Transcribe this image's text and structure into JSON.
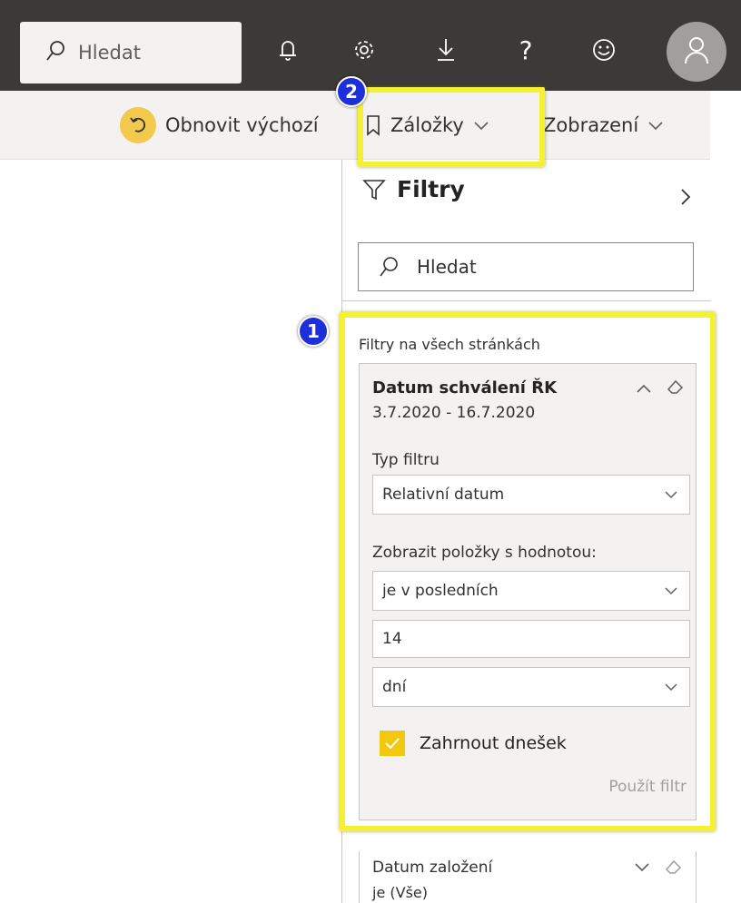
{
  "topbar": {
    "search_label": "Hledat",
    "icons": [
      "search-icon",
      "bell-icon",
      "gear-icon",
      "download-icon",
      "help-icon",
      "smiley-icon",
      "person-icon"
    ],
    "colors": {
      "background": "#3b3a39",
      "search_box": "#f3f2f1",
      "avatar": "#a19f9d"
    }
  },
  "toolbar": {
    "reset_label": "Obnovit výchozí",
    "bookmarks_label": "Záložky",
    "view_label": "Zobrazení",
    "colors": {
      "reset_circle": "#f2c94c"
    }
  },
  "callouts": [
    {
      "number": "1"
    },
    {
      "number": "2"
    }
  ],
  "filters_pane": {
    "title": "Filtry",
    "search_label": "Hledat",
    "section_label": "Filtry na všech stránkách",
    "filter_card": {
      "title": "Datum schválení ŘK",
      "subtitle": "3.7.2020 - 16.7.2020",
      "filter_type_label": "Typ filtru",
      "filter_type_value": "Relativní datum",
      "show_items_label": "Zobrazit položky s hodnotou:",
      "condition_value": "je v posledních",
      "number_value": "14",
      "unit_value": "dní",
      "include_today_label": "Zahrnout dnešek",
      "include_today_checked": true,
      "apply_label": "Použít filtr"
    },
    "filter_card_2": {
      "title": "Datum založení",
      "subtitle": "je (Vše)"
    }
  },
  "accent_colors": {
    "highlight": "#f5f032",
    "badge": "#1d2fd8",
    "checkbox": "#f2c811"
  }
}
